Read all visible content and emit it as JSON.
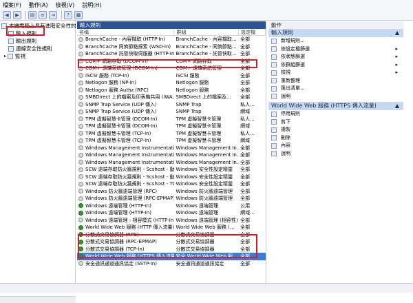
{
  "menu": [
    "檔案(F)",
    "動作(A)",
    "檢視(V)",
    "說明(H)"
  ],
  "tree": {
    "root": "本機電腦上具有進階安全性的 W",
    "items": [
      "輸入規則",
      "輸出規則",
      "連線安全性規則",
      "監視"
    ]
  },
  "middle": {
    "header": "輸入規則",
    "columns": [
      "名稱",
      "群組",
      "設定檔"
    ],
    "rows": [
      {
        "name": "BranchCache - 內容擷取 (HTTP-In)",
        "group": "BranchCache - 內容擷取...",
        "profile": "全部",
        "on": false
      },
      {
        "name": "BranchCache 同儕節點探索 (WSD-In)",
        "group": "BranchCache - 同儕節點...",
        "profile": "全部",
        "on": false
      },
      {
        "name": "BranchCache 託管快取伺服器 (HTTP-In)",
        "group": "BranchCache - 託管快取...",
        "profile": "全部",
        "on": false
      },
      {
        "name": "COM+ 網路存取 (DCOM-In)",
        "group": "COM+ 網路存取",
        "profile": "全部",
        "on": false
      },
      {
        "name": "COM+ 遠端系統管理 (DCOM-In)",
        "group": "COM+ 遠端系統管理",
        "profile": "全部",
        "on": false
      },
      {
        "name": "iSCSI 服務 (TCP-In)",
        "group": "iSCSI 服務",
        "profile": "全部",
        "on": false
      },
      {
        "name": "Netlogon 服務 (NP-In)",
        "group": "Netlogon 服務",
        "profile": "全部",
        "on": false
      },
      {
        "name": "Netlogon 服務 Authz (RPC)",
        "group": "Netlogon 服務",
        "profile": "全部",
        "on": false
      },
      {
        "name": "SMBDirect 上的檔案及印表機共用 (iWA...",
        "group": "SMBDirect 上的檔案及...",
        "profile": "全部",
        "on": false
      },
      {
        "name": "SNMP Trap Service (UDP 傳入)",
        "group": "SNMP Trap",
        "profile": "私人...",
        "on": false
      },
      {
        "name": "SNMP Trap Service (UDP 傳入)",
        "group": "SNMP Trap",
        "profile": "網域",
        "on": false
      },
      {
        "name": "TPM 虛擬智慧卡管理 (DCOM-In)",
        "group": "TPM 虛擬智慧卡管理",
        "profile": "私人...",
        "on": false
      },
      {
        "name": "TPM 虛擬智慧卡管理 (DCOM-In)",
        "group": "TPM 虛擬智慧卡管理",
        "profile": "網域",
        "on": false
      },
      {
        "name": "TPM 虛擬智慧卡管理 (TCP-In)",
        "group": "TPM 虛擬智慧卡管理",
        "profile": "私人...",
        "on": false
      },
      {
        "name": "TPM 虛擬智慧卡管理 (TCP-In)",
        "group": "TPM 虛擬智慧卡管理",
        "profile": "網域",
        "on": false
      },
      {
        "name": "Windows Management Instrumentatio...",
        "group": "Windows Management In...",
        "profile": "全部",
        "on": false
      },
      {
        "name": "Windows Management Instrumentatio...",
        "group": "Windows Management In...",
        "profile": "全部",
        "on": false
      },
      {
        "name": "Windows Management Instrumentatio...",
        "group": "Windows Management In...",
        "profile": "全部",
        "on": false
      },
      {
        "name": "SCW 遠端存取防火牆規則 - Scshost - 動...",
        "group": "Windows 安全性設定精靈",
        "profile": "全部",
        "on": false
      },
      {
        "name": "SCW 遠端存取防火牆規則 - Scshost - 動...",
        "group": "Windows 安全性設定精靈",
        "profile": "全部",
        "on": false
      },
      {
        "name": "SCW 遠端存取防火牆規則 - Scshost - TCP",
        "group": "Windows 安全性設定精靈",
        "profile": "全部",
        "on": false
      },
      {
        "name": "Windows 防火牆遠端管理 (RPC)",
        "group": "Windows 防火牆遠端管理",
        "profile": "全部",
        "on": false
      },
      {
        "name": "Windows 防火牆遠端管理 (RPC-EPMAP)",
        "group": "Windows 防火牆遠端管理",
        "profile": "全部",
        "on": false
      },
      {
        "name": "Windows 遠端管理 (HTTP-In)",
        "group": "Windows 遠端管理",
        "profile": "公用",
        "on": true
      },
      {
        "name": "Windows 遠端管理 (HTTP-In)",
        "group": "Windows 遠端管理",
        "profile": "網域...",
        "on": true
      },
      {
        "name": "Windows 遠端管理 - 相容模式 (HTTP-In)",
        "group": "Windows 遠端管理 (相容性)",
        "profile": "全部",
        "on": false
      },
      {
        "name": "World Wide Web 服務 (HTTP 傳入流量)",
        "group": "World Wide Web 服務 (...",
        "profile": "全部",
        "on": true
      },
      {
        "name": "分散式交易協調器 (RPC)",
        "group": "分散式交易協調器",
        "profile": "全部",
        "on": true
      },
      {
        "name": "分散式交易協調器 (RPC-EPMAP)",
        "group": "分散式交易協調器",
        "profile": "全部",
        "on": true
      },
      {
        "name": "分散式交易協調器 (TCP-In)",
        "group": "分散式交易協調器",
        "profile": "全部",
        "on": true
      },
      {
        "name": "World Wide Web 服務 (HTTPS 傳入流量)",
        "group": "安全 World Wide Web 服...",
        "profile": "全部",
        "on": true,
        "selected": true
      },
      {
        "name": "安全通訊通道通訊協定 (SSTP-In)",
        "group": "安全通訊通道通訊協定",
        "profile": "全部",
        "on": false
      }
    ]
  },
  "actions": {
    "header": "動作",
    "section1": "輸入規則",
    "section1_items": [
      {
        "label": "新增規則...",
        "arrow": false
      },
      {
        "label": "依設定檔篩選",
        "arrow": true
      },
      {
        "label": "依狀態篩選",
        "arrow": true
      },
      {
        "label": "依群組篩選",
        "arrow": true
      },
      {
        "label": "檢視",
        "arrow": true
      },
      {
        "label": "重新整理",
        "arrow": false
      },
      {
        "label": "匯出清單...",
        "arrow": false
      },
      {
        "label": "說明",
        "arrow": false
      }
    ],
    "section2": "World Wide Web 服務 (HTTPS 傳入流量)",
    "section2_items": [
      {
        "label": "停用規則"
      },
      {
        "label": "剪下"
      },
      {
        "label": "複製"
      },
      {
        "label": "刪除"
      },
      {
        "label": "內容"
      },
      {
        "label": "說明"
      }
    ]
  }
}
